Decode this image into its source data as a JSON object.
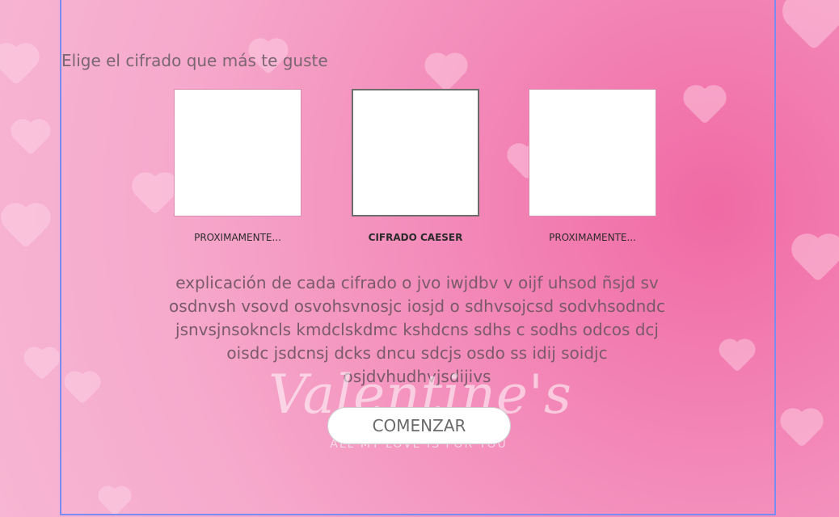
{
  "header": {
    "subtitle": "Elige el cifrado que más te guste"
  },
  "tiles": [
    {
      "label": "PROXIMAMENTE...",
      "selected": false
    },
    {
      "label": "CIFRADO CAESER",
      "selected": true
    },
    {
      "label": "PROXIMAMENTE...",
      "selected": false
    }
  ],
  "description": "explicación de cada cifrado o jvo iwjdbv v oijf uhsod ñsjd sv osdnvsh vsovd osvohsvnosjc iosjd o sdhvsojcsd sodvhsodndc jsnvsjnsokncls kmdclskdmc kshdcns sdhs c sodhs odcos dcj oisdc jsdcnsj dcks dncu  sdcjs  osdo ss idij soidjc osjdvhudhvjsdijivs",
  "background": {
    "title": "Valentine's",
    "subtitle": "ALL MY LOVE IS FOR YOU"
  },
  "actions": {
    "start_label": "COMENZAR"
  }
}
